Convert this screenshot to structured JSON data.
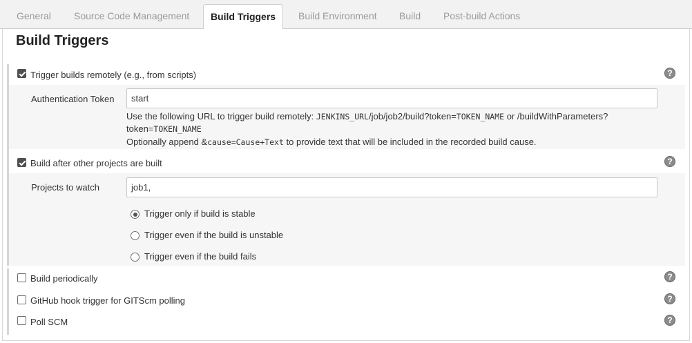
{
  "tabs": [
    {
      "label": "General"
    },
    {
      "label": "Source Code Management"
    },
    {
      "label": "Build Triggers"
    },
    {
      "label": "Build Environment"
    },
    {
      "label": "Build"
    },
    {
      "label": "Post-build Actions"
    }
  ],
  "active_tab": "Build Triggers",
  "section": {
    "title": "Build Triggers"
  },
  "triggers": {
    "remote": {
      "label": "Trigger builds remotely (e.g., from scripts)",
      "checked": true,
      "token_label": "Authentication Token",
      "token_value": "start",
      "desc_prefix": "Use the following URL to trigger build remotely: ",
      "desc_url_var": "JENKINS_URL",
      "desc_url_path": "/job/job2/build?token=",
      "desc_token_var": "TOKEN_NAME",
      "desc_or": " or /buildWithParameters?",
      "desc_line2_key": "token=",
      "desc_line2_var": "TOKEN_NAME",
      "desc_line3_prefix": "Optionally append ",
      "desc_line3_amp": "&",
      "desc_line3_code": "cause=Cause+Text",
      "desc_line3_suffix": " to provide text that will be included in the recorded build cause."
    },
    "after_other": {
      "label": "Build after other projects are built",
      "checked": true,
      "projects_label": "Projects to watch",
      "projects_value": "job1,",
      "options": [
        {
          "label": "Trigger only if build is stable",
          "selected": true
        },
        {
          "label": "Trigger even if the build is unstable",
          "selected": false
        },
        {
          "label": "Trigger even if the build fails",
          "selected": false
        }
      ]
    },
    "periodically": {
      "label": "Build periodically",
      "checked": false
    },
    "github_hook": {
      "label": "GitHub hook trigger for GITScm polling",
      "checked": false
    },
    "poll_scm": {
      "label": "Poll SCM",
      "checked": false
    }
  },
  "help_icon": "question-circle-icon"
}
